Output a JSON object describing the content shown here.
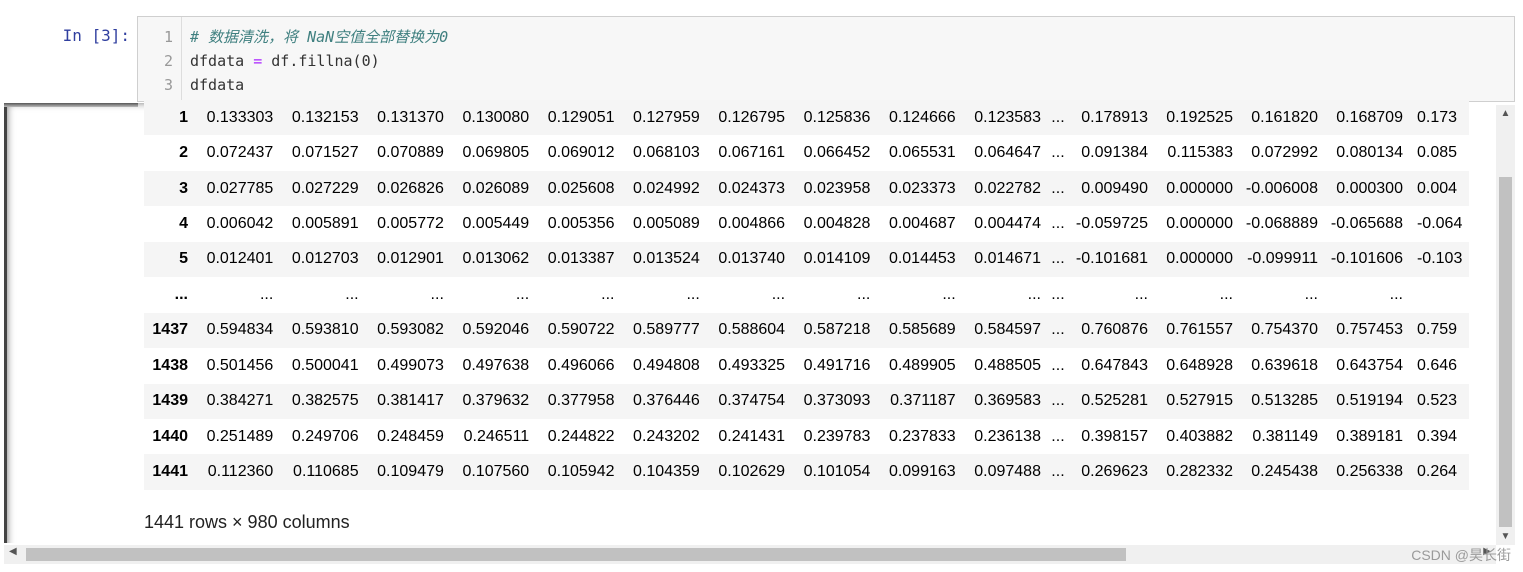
{
  "cell": {
    "prompt": "In  [3]:",
    "line_numbers": [
      "1",
      "2",
      "3"
    ],
    "code": {
      "comment": "# 数据清洗，将 NaN空值全部替换为0",
      "line2_var": "dfdata",
      "line2_op": " = ",
      "line2_expr": "df.fillna(0)",
      "line3": "dfdata"
    }
  },
  "output": {
    "rows": [
      {
        "index": "1",
        "left": [
          "0.133303",
          "0.132153",
          "0.131370",
          "0.130080",
          "0.129051",
          "0.127959",
          "0.126795",
          "0.125836",
          "0.124666",
          "0.123583"
        ],
        "ellipsis": "...",
        "right": [
          "0.178913",
          "0.192525",
          "0.161820",
          "0.168709"
        ],
        "clip": "0.173"
      },
      {
        "index": "2",
        "left": [
          "0.072437",
          "0.071527",
          "0.070889",
          "0.069805",
          "0.069012",
          "0.068103",
          "0.067161",
          "0.066452",
          "0.065531",
          "0.064647"
        ],
        "ellipsis": "...",
        "right": [
          "0.091384",
          "0.115383",
          "0.072992",
          "0.080134"
        ],
        "clip": "0.085"
      },
      {
        "index": "3",
        "left": [
          "0.027785",
          "0.027229",
          "0.026826",
          "0.026089",
          "0.025608",
          "0.024992",
          "0.024373",
          "0.023958",
          "0.023373",
          "0.022782"
        ],
        "ellipsis": "...",
        "right": [
          "0.009490",
          "0.000000",
          "-0.006008",
          "0.000300"
        ],
        "clip": "0.004"
      },
      {
        "index": "4",
        "left": [
          "0.006042",
          "0.005891",
          "0.005772",
          "0.005449",
          "0.005356",
          "0.005089",
          "0.004866",
          "0.004828",
          "0.004687",
          "0.004474"
        ],
        "ellipsis": "...",
        "right": [
          "-0.059725",
          "0.000000",
          "-0.068889",
          "-0.065688"
        ],
        "clip": "-0.064"
      },
      {
        "index": "5",
        "left": [
          "0.012401",
          "0.012703",
          "0.012901",
          "0.013062",
          "0.013387",
          "0.013524",
          "0.013740",
          "0.014109",
          "0.014453",
          "0.014671"
        ],
        "ellipsis": "...",
        "right": [
          "-0.101681",
          "0.000000",
          "-0.099911",
          "-0.101606"
        ],
        "clip": "-0.103"
      },
      {
        "index": "...",
        "left": [
          "...",
          "...",
          "...",
          "...",
          "...",
          "...",
          "...",
          "...",
          "...",
          "..."
        ],
        "ellipsis": "...",
        "right": [
          "...",
          "...",
          "...",
          "..."
        ],
        "clip": ""
      },
      {
        "index": "1437",
        "left": [
          "0.594834",
          "0.593810",
          "0.593082",
          "0.592046",
          "0.590722",
          "0.589777",
          "0.588604",
          "0.587218",
          "0.585689",
          "0.584597"
        ],
        "ellipsis": "...",
        "right": [
          "0.760876",
          "0.761557",
          "0.754370",
          "0.757453"
        ],
        "clip": "0.759"
      },
      {
        "index": "1438",
        "left": [
          "0.501456",
          "0.500041",
          "0.499073",
          "0.497638",
          "0.496066",
          "0.494808",
          "0.493325",
          "0.491716",
          "0.489905",
          "0.488505"
        ],
        "ellipsis": "...",
        "right": [
          "0.647843",
          "0.648928",
          "0.639618",
          "0.643754"
        ],
        "clip": "0.646"
      },
      {
        "index": "1439",
        "left": [
          "0.384271",
          "0.382575",
          "0.381417",
          "0.379632",
          "0.377958",
          "0.376446",
          "0.374754",
          "0.373093",
          "0.371187",
          "0.369583"
        ],
        "ellipsis": "...",
        "right": [
          "0.525281",
          "0.527915",
          "0.513285",
          "0.519194"
        ],
        "clip": "0.523"
      },
      {
        "index": "1440",
        "left": [
          "0.251489",
          "0.249706",
          "0.248459",
          "0.246511",
          "0.244822",
          "0.243202",
          "0.241431",
          "0.239783",
          "0.237833",
          "0.236138"
        ],
        "ellipsis": "...",
        "right": [
          "0.398157",
          "0.403882",
          "0.381149",
          "0.389181"
        ],
        "clip": "0.394"
      },
      {
        "index": "1441",
        "left": [
          "0.112360",
          "0.110685",
          "0.109479",
          "0.107560",
          "0.105942",
          "0.104359",
          "0.102629",
          "0.101054",
          "0.099163",
          "0.097488"
        ],
        "ellipsis": "...",
        "right": [
          "0.269623",
          "0.282332",
          "0.245438",
          "0.256338"
        ],
        "clip": "0.264"
      }
    ],
    "shape_text": "1441 rows × 980 columns"
  },
  "scrollbars": {
    "up_arrow": "▲",
    "down_arrow": "▼",
    "left_arrow": "◀",
    "right_arrow": "▶"
  },
  "watermark": "CSDN @昊长街"
}
